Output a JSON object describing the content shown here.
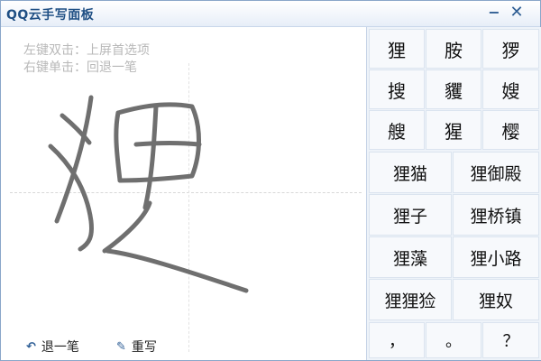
{
  "window": {
    "title": "QQ云手写面板",
    "minimize_glyph": "−",
    "close_glyph": "✕"
  },
  "pad": {
    "hint_line1": "左键双击：上屏首选项",
    "hint_line2": "右键单击：回退一笔",
    "stroke_color": "#6f6f6f"
  },
  "actions": {
    "undo_label": "退一笔",
    "undo_icon": "undo-arrow-icon",
    "rewrite_label": "重写",
    "rewrite_icon": "eraser-icon"
  },
  "candidates": {
    "single_rows": [
      [
        "狸",
        "胺",
        "猡"
      ],
      [
        "搜",
        "貜",
        "嫂"
      ],
      [
        "艘",
        "猩",
        "樱"
      ]
    ],
    "word_rows": [
      [
        "狸猫",
        "狸御殿"
      ],
      [
        "狸子",
        "狸桥镇"
      ],
      [
        "狸藻",
        "狸小路"
      ],
      [
        "狸狸猃",
        "狸奴"
      ]
    ],
    "punct_row": [
      "，",
      "。",
      "？"
    ]
  }
}
